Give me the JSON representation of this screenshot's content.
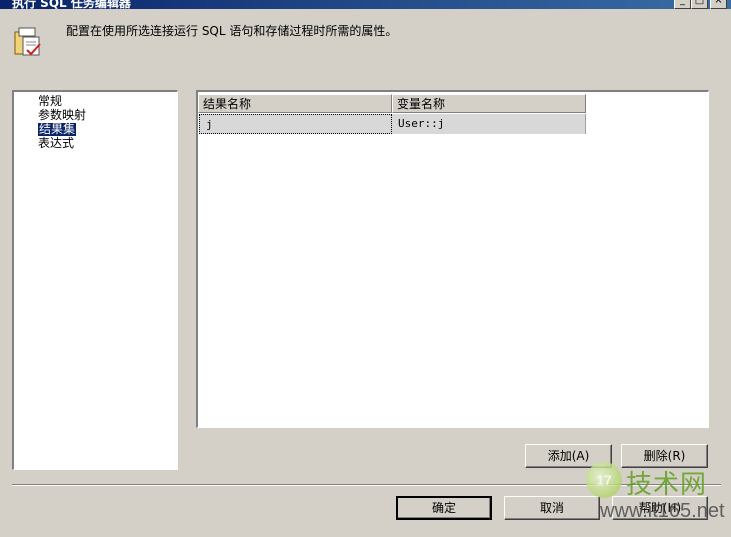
{
  "window": {
    "title": "执行 SQL 任务编辑器",
    "minimize_glyph": "_",
    "maximize_glyph": "□",
    "close_glyph": "×"
  },
  "header": {
    "description": "配置在使用所选连接运行 SQL 语句和存储过程时所需的属性。",
    "icon": "task-editor-icon"
  },
  "nav": {
    "items": [
      {
        "label": "常规",
        "selected": false
      },
      {
        "label": "参数映射",
        "selected": false
      },
      {
        "label": "结果集",
        "selected": true
      },
      {
        "label": "表达式",
        "selected": false
      }
    ]
  },
  "result_grid": {
    "columns": [
      "结果名称",
      "变量名称"
    ],
    "rows": [
      {
        "result_name": "j",
        "variable_name": "User::j"
      }
    ]
  },
  "buttons": {
    "add": "添加(A)",
    "delete": "删除(R)",
    "ok": "确定",
    "cancel": "取消",
    "help": "帮助(H)"
  },
  "watermark": {
    "logo_text": "17",
    "title": "技术网",
    "url": "www.it165.net"
  },
  "colors": {
    "selection": "#0a246a",
    "dialog_bg": "#d4d0c8"
  }
}
